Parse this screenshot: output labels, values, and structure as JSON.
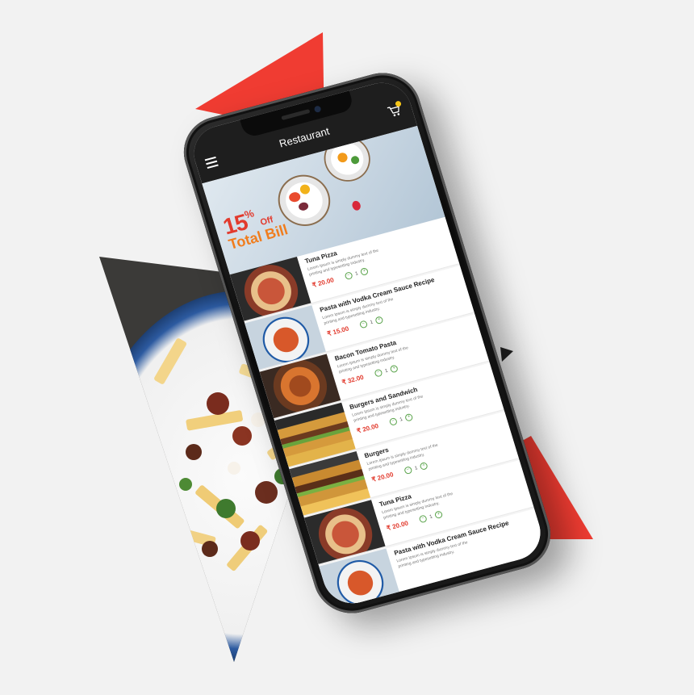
{
  "app": {
    "title": "Restaurant",
    "menu_icon": "hamburger-menu-icon",
    "cart_icon": "cart-icon"
  },
  "banner": {
    "percent": "15",
    "percent_sign": "%",
    "off": "Off",
    "total": "Total Bill"
  },
  "items": [
    {
      "name": "Tuna Pizza",
      "desc": "Lorem Ipsum is simply dummy text of the printing and typesetting industry.",
      "price": "₹ 20.00",
      "qty": "1",
      "thumb": "pizza"
    },
    {
      "name": "Pasta with Vodka Cream Sauce Recipe",
      "desc": "Lorem Ipsum is simply dummy text of the printing and typesetting industry.",
      "price": "₹ 15.00",
      "qty": "1",
      "thumb": "pasta"
    },
    {
      "name": "Bacon Tomato Pasta",
      "desc": "Lorem Ipsum is simply dummy text of the printing and typesetting industry.",
      "price": "₹ 32.00",
      "qty": "1",
      "thumb": "noodles"
    },
    {
      "name": "Burgers and Sandwich",
      "desc": "Lorem Ipsum is simply dummy text of the printing and typesetting industry.",
      "price": "₹ 20.00",
      "qty": "1",
      "thumb": "burger"
    },
    {
      "name": "Burgers",
      "desc": "Lorem Ipsum is simply dummy text of the printing and typesetting industry.",
      "price": "₹ 20.00",
      "qty": "1",
      "thumb": "burger2"
    },
    {
      "name": "Tuna Pizza",
      "desc": "Lorem Ipsum is simply dummy text of the printing and typesetting industry.",
      "price": "₹ 20.00",
      "qty": "1",
      "thumb": "pizza"
    },
    {
      "name": "Pasta with Vodka Cream Sauce Recipe",
      "desc": "Lorem Ipsum is simply dummy text of the printing and typesetting industry.",
      "price": "",
      "qty": "",
      "thumb": "pasta"
    }
  ],
  "colors": {
    "accent_red": "#f03c32",
    "price_red": "#e23a2d",
    "banner_orange": "#f07d1e",
    "qty_green": "#59a34a",
    "appbar": "#1e1e1e"
  }
}
